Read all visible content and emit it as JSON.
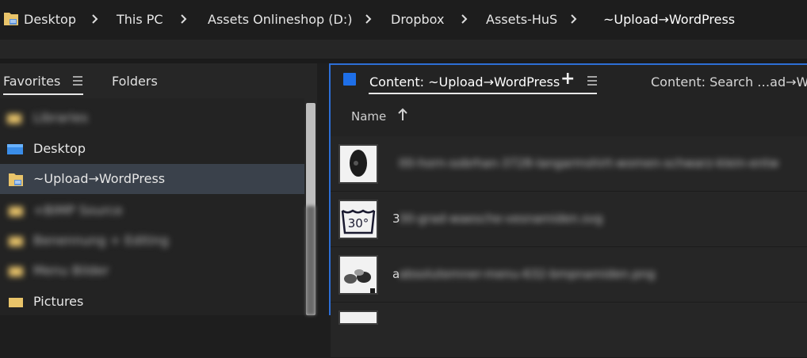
{
  "breadcrumb": {
    "items": [
      "Desktop",
      "This PC",
      "Assets Onlineshop (D:)",
      "Dropbox",
      "Assets-HuS",
      "~Upload→WordPress"
    ]
  },
  "left_panel": {
    "tabs": [
      "Favorites",
      "Folders"
    ],
    "tree": [
      {
        "label": "Libraries",
        "blurred": true
      },
      {
        "label": "Desktop",
        "blurred": false
      },
      {
        "label": "~Upload→WordPress",
        "blurred": false,
        "selected": true
      },
      {
        "label": "+BIMP Source",
        "blurred": true
      },
      {
        "label": "Benennung + Editing",
        "blurred": true
      },
      {
        "label": "Menu Bilder",
        "blurred": true
      },
      {
        "label": "Pictures",
        "blurred": false
      }
    ]
  },
  "right_panel": {
    "active_tab": "Content: ~Upload→WordPress",
    "second_tab": "Content: Search …ad→Wor",
    "column_name": "Name",
    "files": [
      {
        "prefix": "",
        "name": "00-horn-sobrhan-3728-langarmshirt-women-schwarz-klein-entw"
      },
      {
        "prefix": "3",
        "name": "30-grad-waesche-vesnamiden.svg"
      },
      {
        "prefix": "a",
        "name": "absolutemner-menu-632-bmpnamiden.png"
      }
    ]
  },
  "colors": {
    "accent": "#2d6fd6",
    "selected_row": "#3a414b",
    "background": "#1e1e1e"
  }
}
